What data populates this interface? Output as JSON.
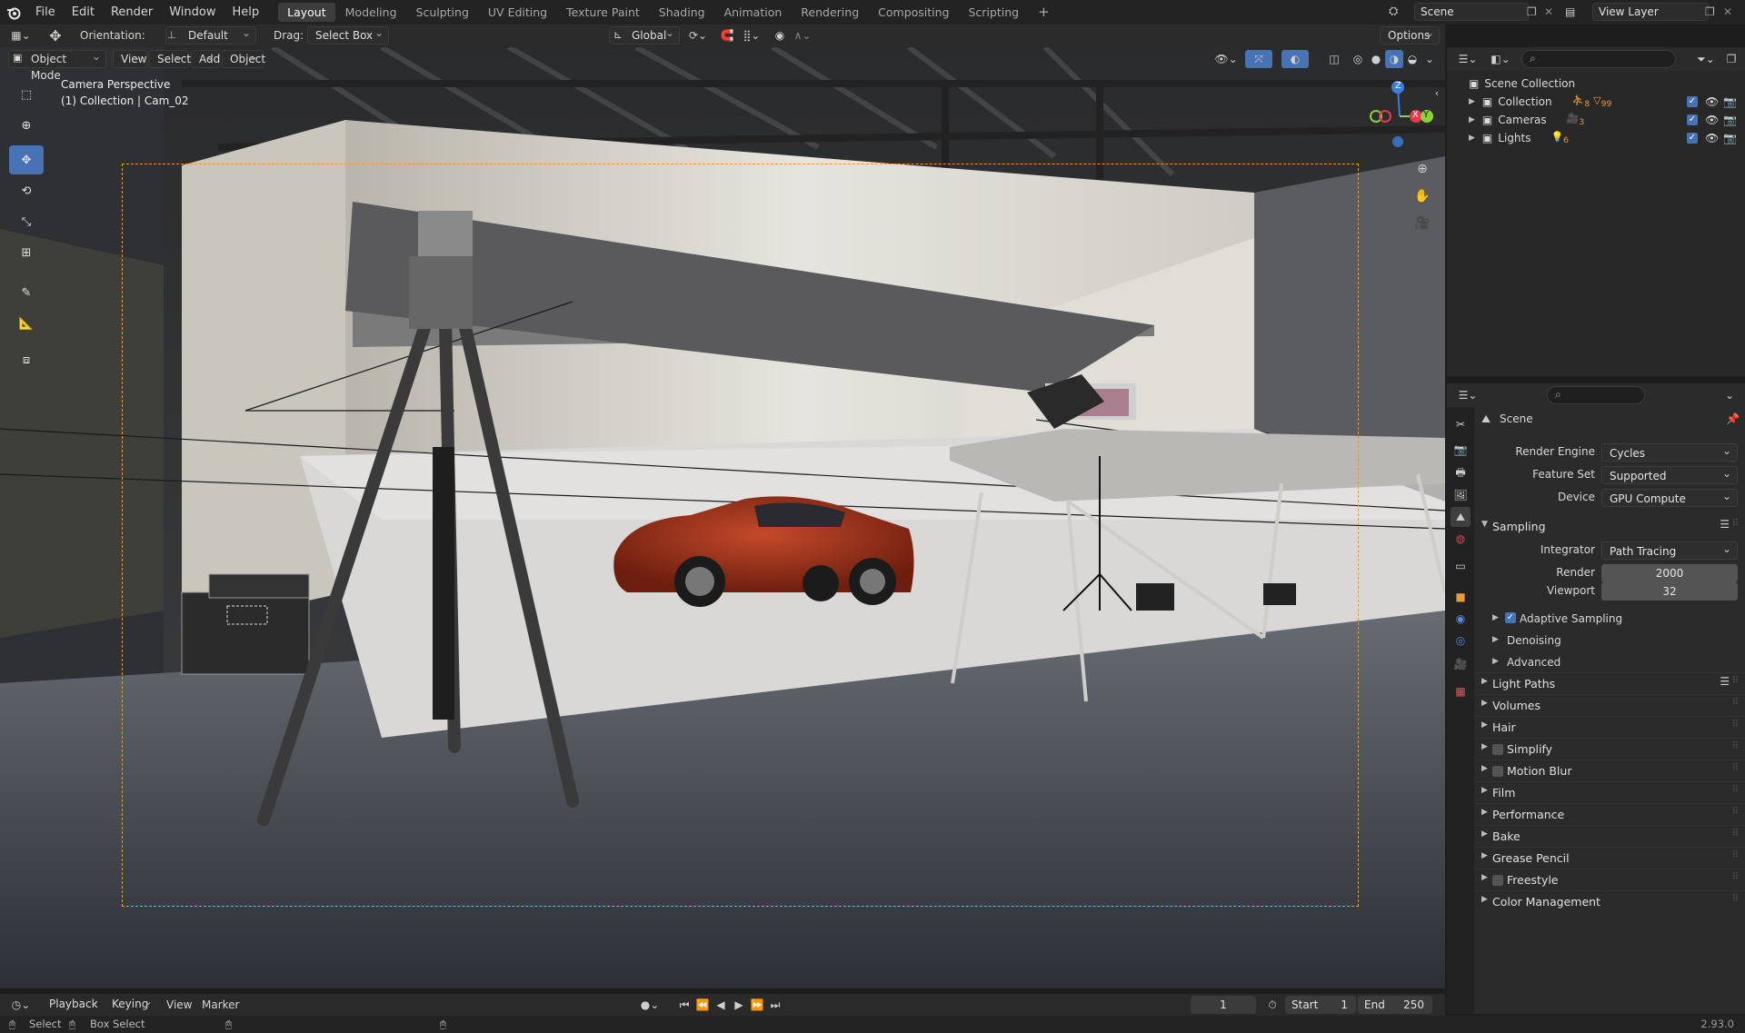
{
  "app": {
    "version": "2.93.0"
  },
  "topbar": {
    "menus": [
      "File",
      "Edit",
      "Render",
      "Window",
      "Help"
    ],
    "workspaces": [
      "Layout",
      "Modeling",
      "Sculpting",
      "UV Editing",
      "Texture Paint",
      "Shading",
      "Animation",
      "Rendering",
      "Compositing",
      "Scripting"
    ],
    "active_workspace": "Layout",
    "add_tab": "+",
    "scene": "Scene",
    "view_layer": "View Layer"
  },
  "toolheader": {
    "orientation_label": "Orientation:",
    "orientation_value": "Default",
    "drag_label": "Drag:",
    "drag_value": "Select Box",
    "transform_orientation": "Global",
    "options": "Options"
  },
  "viewport_header": {
    "mode": "Object Mode",
    "menus": [
      "View",
      "Select",
      "Add",
      "Object"
    ]
  },
  "viewport": {
    "title": "Camera Perspective",
    "subtitle": "(1) Collection | Cam_02",
    "gizmo": {
      "z": "Z",
      "x": "X",
      "y": "Y"
    }
  },
  "outliner": {
    "search_placeholder": "",
    "root": "Scene Collection",
    "items": [
      {
        "label": "Collection",
        "badge1": "8",
        "badge2": "99"
      },
      {
        "label": "Cameras",
        "badge1": "3",
        "badge2": ""
      },
      {
        "label": "Lights",
        "badge1": "6",
        "badge2": ""
      }
    ]
  },
  "properties": {
    "context": "Scene",
    "render_engine_label": "Render Engine",
    "render_engine": "Cycles",
    "feature_set_label": "Feature Set",
    "feature_set": "Supported",
    "device_label": "Device",
    "device": "GPU Compute",
    "sampling": {
      "title": "Sampling",
      "integrator_label": "Integrator",
      "integrator": "Path Tracing",
      "render_label": "Render",
      "render": "2000",
      "viewport_label": "Viewport",
      "viewport": "32",
      "adaptive": "Adaptive Sampling",
      "denoising": "Denoising",
      "advanced": "Advanced"
    },
    "panels": [
      {
        "label": "Light Paths",
        "checkbox": false
      },
      {
        "label": "Volumes",
        "checkbox": false
      },
      {
        "label": "Hair",
        "checkbox": false
      },
      {
        "label": "Simplify",
        "checkbox": true
      },
      {
        "label": "Motion Blur",
        "checkbox": true
      },
      {
        "label": "Film",
        "checkbox": false
      },
      {
        "label": "Performance",
        "checkbox": false
      },
      {
        "label": "Bake",
        "checkbox": false
      },
      {
        "label": "Grease Pencil",
        "checkbox": false
      },
      {
        "label": "Freestyle",
        "checkbox": true
      },
      {
        "label": "Color Management",
        "checkbox": false
      }
    ]
  },
  "timeline": {
    "menus": [
      "Playback",
      "Keying",
      "View",
      "Marker"
    ],
    "current_frame": "1",
    "start_label": "Start",
    "start": "1",
    "end_label": "End",
    "end": "250"
  },
  "statusbar": {
    "select": "Select",
    "box_select": "Box Select"
  },
  "colors": {
    "accent": "#4772b3",
    "camera_frame": "#e09a35",
    "car": "#9b2f1a"
  }
}
